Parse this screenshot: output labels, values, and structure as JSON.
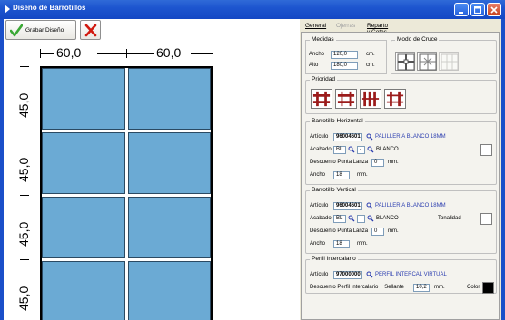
{
  "window": {
    "title": "Diseño de Barrotillos"
  },
  "toolbar": {
    "save_label": "Grabar Diseño"
  },
  "design": {
    "top_dims": [
      "60,0",
      "60,0"
    ],
    "left_dims": [
      "45,0",
      "45,0",
      "45,0",
      "45,0"
    ],
    "pane_color": "#6baad4"
  },
  "tabs": [
    {
      "label": "General",
      "active": true
    },
    {
      "label": "Ojerras",
      "active": false
    },
    {
      "label": "Reparto y Cotas",
      "active": false
    }
  ],
  "medidas": {
    "title": "Medidas",
    "ancho_label": "Ancho",
    "ancho_value": "120,0",
    "ancho_unit": "cm.",
    "alto_label": "Alto",
    "alto_value": "180,0",
    "alto_unit": "cm."
  },
  "modo_cruce": {
    "title": "Modo de Cruce"
  },
  "prioridad": {
    "title": "Prioridad",
    "accent": "#9b1b1b"
  },
  "barrotillo_horizontal": {
    "title": "Barrotillo Horizontal",
    "articulo_label": "Artículo",
    "articulo_value": "96004601",
    "articulo_desc": "PALILLERIA BLANCO 18MM",
    "acabado_label": "Acabado",
    "acabado_code": "BL",
    "acabado_sub": "-",
    "acabado_desc": "BLANCO",
    "descuento_label": "Descuento Punta Lanza",
    "descuento_value": "0",
    "descuento_unit": "mm.",
    "ancho_label": "Ancho",
    "ancho_value": "18",
    "ancho_unit": "mm."
  },
  "barrotillo_vertical": {
    "title": "Barrotillo Vertical",
    "articulo_label": "Artículo",
    "articulo_value": "96004601",
    "articulo_desc": "PALILLERIA BLANCO 18MM",
    "acabado_label": "Acabado",
    "acabado_code": "BL",
    "acabado_sub": "-",
    "acabado_desc": "BLANCO",
    "tonalidad_label": "Tonalidad",
    "descuento_label": "Descuento Punta Lanza",
    "descuento_value": "0",
    "descuento_unit": "mm.",
    "ancho_label": "Ancho",
    "ancho_value": "18",
    "ancho_unit": "mm."
  },
  "perfil_intercalario": {
    "title": "Perfil Intercalario",
    "articulo_label": "Artículo",
    "articulo_value": "97000000",
    "articulo_desc": "PERFIL INTERCAL VIRTUAL",
    "descuento_label": "Descuento Perfil Intercalario + Sellante",
    "descuento_value": "10,2",
    "descuento_unit": "mm.",
    "color_label": "Color",
    "color_value": "#000000"
  }
}
